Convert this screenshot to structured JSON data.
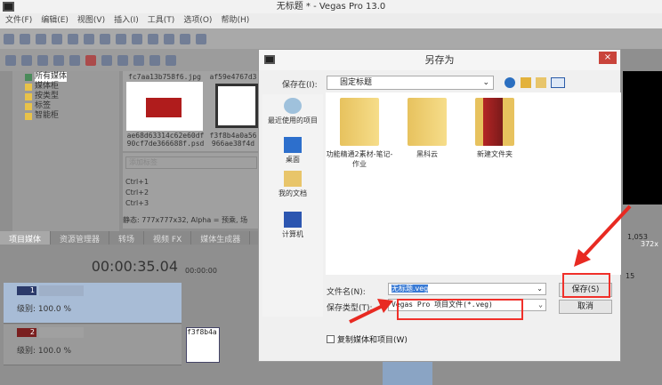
{
  "window": {
    "title": "无标题 * - Vegas Pro 13.0"
  },
  "menu": [
    "文件(F)",
    "编辑(E)",
    "视图(V)",
    "插入(I)",
    "工具(T)",
    "选项(O)",
    "帮助(H)"
  ],
  "tree": [
    "所有媒体",
    "媒体柜",
    "按类型",
    "标签",
    "智能柜"
  ],
  "thumbs": {
    "t1_top": "fc7aa13b758f6.jpg",
    "t2_top": "af59e4767d3",
    "t1_name": "ae68d63314c62e60df 90cf7de366688f.psd",
    "t2_name": "f3f8b4a0a56 966ae38f4d"
  },
  "tags": {
    "placeholder": "添加标签",
    "shortcuts": [
      "Ctrl+1",
      "Ctrl+2",
      "Ctrl+3"
    ],
    "info": "静态: 777x777x32, Alpha = 预乘, 场"
  },
  "tabs": [
    "项目媒体",
    "资源管理器",
    "转场",
    "视频 FX",
    "媒体生成器"
  ],
  "timeline": {
    "timecode": "00:00:35.04",
    "ruler": "00:00:00",
    "clip": "f3f8b4a",
    "tracks": [
      {
        "num": "1",
        "level": "级别: 100.0 %"
      },
      {
        "num": "2",
        "level": "级别: 100.0 %"
      }
    ]
  },
  "preview": {
    "info1": "1,053",
    "info2": "372x",
    "ruler": "15"
  },
  "dialog": {
    "title": "另存为",
    "close": "×",
    "save_in_label": "保存在(I):",
    "save_in_value": "固定标题",
    "nav": [
      "最近使用的项目",
      "桌面",
      "我的文档",
      "计算机"
    ],
    "files": [
      "功能精通2素材-笔记-作业",
      "黑科云",
      "新建文件夹"
    ],
    "filename_label": "文件名(N):",
    "filename_value": "无标题.veg",
    "filetype_label": "保存类型(T):",
    "filetype_value": "Vegas Pro 项目文件(*.veg)",
    "save": "保存(S)",
    "cancel": "取消",
    "copy_media": "复制媒体和项目(W)"
  },
  "colors": {
    "highlight": "#f0302a",
    "accent_track": "#a8bcd6"
  }
}
